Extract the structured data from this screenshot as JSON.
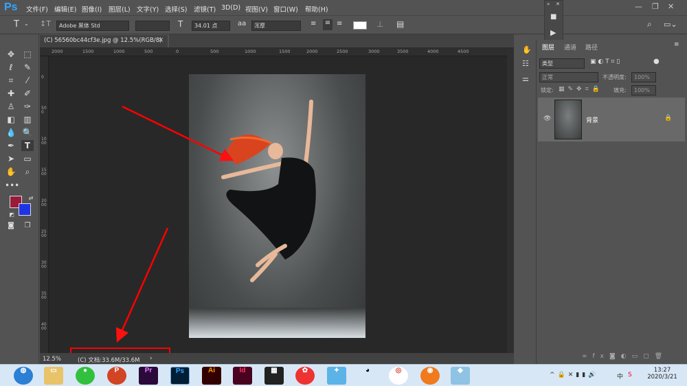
{
  "app": {
    "logo": "Ps"
  },
  "menu": [
    "文件(F)",
    "编辑(E)",
    "图像(I)",
    "图层(L)",
    "文字(Y)",
    "选择(S)",
    "滤镜(T)",
    "3D(D)",
    "视图(V)",
    "窗口(W)",
    "帮助(H)"
  ],
  "options": {
    "font_family": "Adobe 黑体 Std",
    "font_size": "34.01 点",
    "antialias_icon": "aa",
    "antialias": "浑厚",
    "swatch_color": "#ffffff"
  },
  "document": {
    "tab_title": "(C) 56560bc44cf3e.jpg @ 12.5%(RGB/8)",
    "close_label": "×"
  },
  "rulers": {
    "h_ticks": [
      {
        "label": "2000"
      },
      {
        "label": "1500"
      },
      {
        "label": "1000"
      },
      {
        "label": "500"
      },
      {
        "label": "0"
      },
      {
        "label": "500"
      },
      {
        "label": "1000"
      },
      {
        "label": "1500"
      },
      {
        "label": "2000"
      },
      {
        "label": "2500"
      },
      {
        "label": "3000"
      },
      {
        "label": "3500"
      },
      {
        "label": "4000"
      },
      {
        "label": "4500"
      }
    ],
    "v_ticks": [
      {
        "label": "0"
      },
      {
        "label": "500"
      },
      {
        "label": "1000"
      },
      {
        "label": "1500"
      },
      {
        "label": "2000"
      },
      {
        "label": "2500"
      },
      {
        "label": "3000"
      },
      {
        "label": "3500"
      },
      {
        "label": "4000"
      }
    ]
  },
  "status": {
    "zoom": "12.5%",
    "doc_info": "(C) 文档:33.6M/33.6M",
    "arrow": "›"
  },
  "layers_panel": {
    "tabs": [
      "图层",
      "通道",
      "路径"
    ],
    "filter_kind": "类型",
    "blend_mode": "正常",
    "opacity_label": "不透明度:",
    "opacity_value": "100%",
    "lock_label": "锁定:",
    "fill_label": "填充:",
    "fill_value": "100%",
    "layer_name": "背景"
  },
  "colors": {
    "foreground": "#9a1a3a",
    "background": "#1f33e6"
  },
  "annotations": {
    "color": "#ff0000"
  },
  "taskbar": {
    "apps": [
      {
        "name": "Pr",
        "color": "#2a0a3a",
        "fg": "#e87aff"
      },
      {
        "name": "Ps",
        "color": "#001e36",
        "fg": "#31a8ff"
      },
      {
        "name": "Ai",
        "color": "#330000",
        "fg": "#ff9a00"
      },
      {
        "name": "Id",
        "color": "#49021f",
        "fg": "#ff3366"
      }
    ],
    "time": "13:27",
    "date": "2020/3/21",
    "lang_icon": "中",
    "ime_icon": "S"
  }
}
